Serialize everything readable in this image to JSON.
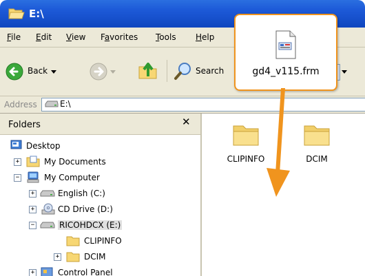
{
  "window": {
    "title": "E:\\"
  },
  "menu": [
    {
      "pre": "",
      "u": "F",
      "post": "ile"
    },
    {
      "pre": "",
      "u": "E",
      "post": "dit"
    },
    {
      "pre": "",
      "u": "V",
      "post": "iew"
    },
    {
      "pre": "F",
      "u": "a",
      "post": "vorites"
    },
    {
      "pre": "",
      "u": "T",
      "post": "ools"
    },
    {
      "pre": "",
      "u": "H",
      "post": "elp"
    }
  ],
  "toolbar": {
    "back_label": "Back",
    "search_label": "Search"
  },
  "address": {
    "label": "Address",
    "value": "E:\\"
  },
  "folders_pane": {
    "title": "Folders",
    "tree": [
      {
        "label": "Desktop"
      },
      {
        "label": "My Documents"
      },
      {
        "label": "My Computer"
      },
      {
        "label": "English (C:)"
      },
      {
        "label": "CD Drive (D:)"
      },
      {
        "label": "RICOHDCX (E:)"
      },
      {
        "label": "CLIPINFO"
      },
      {
        "label": "DCIM"
      },
      {
        "label": "Control Panel"
      }
    ]
  },
  "content": {
    "items": [
      {
        "label": "CLIPINFO"
      },
      {
        "label": "DCIM"
      }
    ]
  },
  "drag_file": {
    "name": "gd4_v115.frm"
  },
  "colors": {
    "accent": "#f0941e",
    "titlebar": "#1d5ad8",
    "chrome": "#ece9d8"
  }
}
